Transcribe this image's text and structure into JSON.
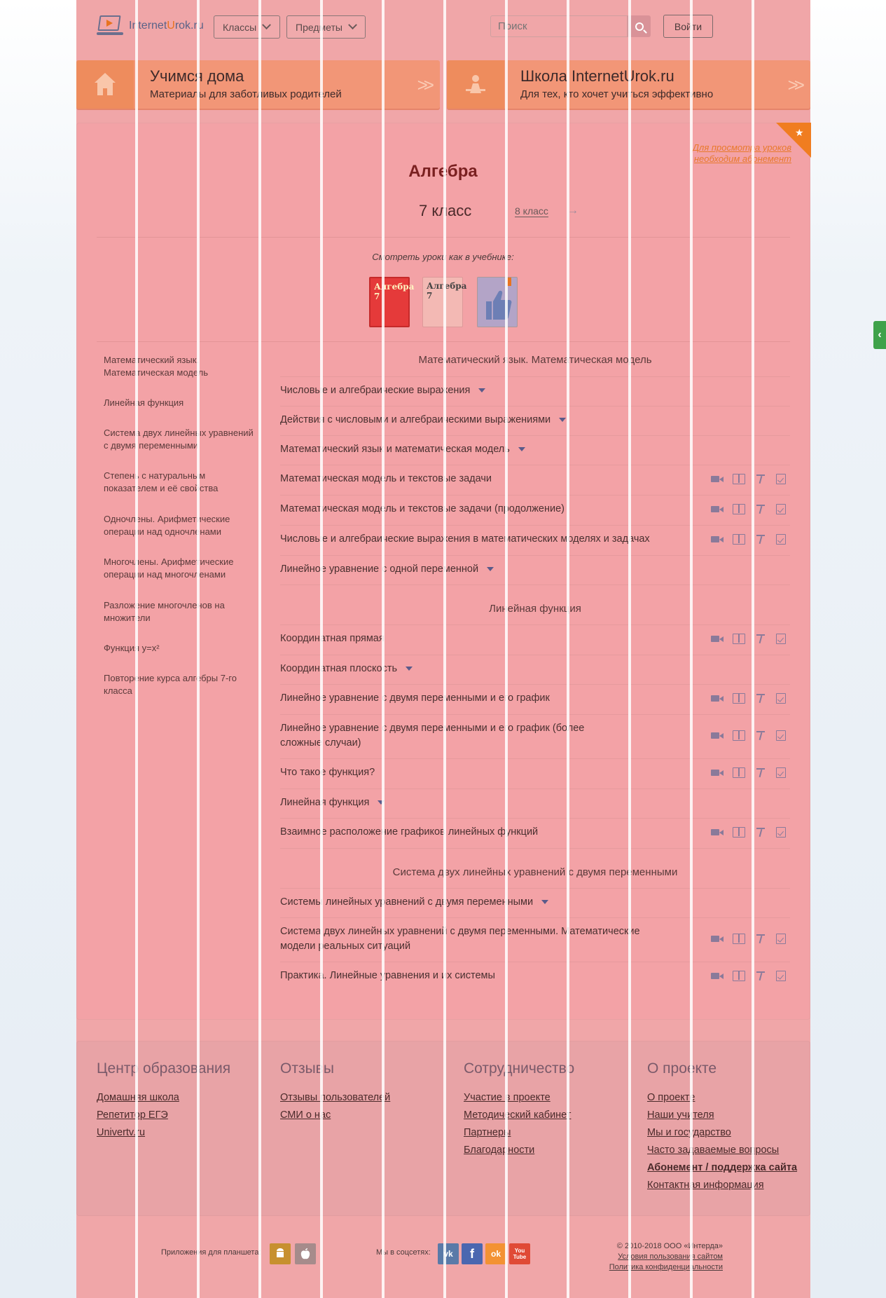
{
  "header": {
    "logo": "InternetUrok.ru",
    "logo_parts": [
      "Internet",
      "U",
      "rok.ru"
    ],
    "classes_label": "Классы",
    "subjects_label": "Предметы",
    "search_placeholder": "Поиск",
    "login_label": "Войти"
  },
  "banners": [
    {
      "title": "Учимся дома",
      "subtitle": "Материалы для заботливых родителей"
    },
    {
      "title": "Школа InternetUrok.ru",
      "subtitle": "Для тех, кто хочет учиться эффективно"
    }
  ],
  "main": {
    "subscription_note": "Для просмотра уроков необходим абонемент",
    "title": "Алгебра",
    "current_grade": "7 класс",
    "next_grade": "8 класс",
    "books_label": "Смотреть уроки как в учебнике:",
    "books": [
      "Алгебра 7",
      "Алгебра 7"
    ]
  },
  "sidebar": {
    "items": [
      "Математический язык. Математическая модель",
      "Линейная функция",
      "Система двух линейных уравнений с двумя переменными",
      "Степень с натуральным показателем и её свойства",
      "Одночлены. Арифметические операции над одночленами",
      "Многочлены. Арифметические операции над многочленами",
      "Разложение многочленов на множители",
      "Функция y=x²",
      "Повторение курса алгебры 7-го класса"
    ]
  },
  "sections": [
    {
      "title": "Математический язык. Математическая модель",
      "lessons": [
        {
          "label": "Числовые и алгебраические выражения",
          "expandable": true
        },
        {
          "label": "Действия с числовыми и алгебраическими выражениями",
          "expandable": true
        },
        {
          "label": "Математический язык и математическая модель",
          "expandable": true
        },
        {
          "label": "Математическая модель и текстовые задачи",
          "expandable": false
        },
        {
          "label": "Математическая модель и текстовые задачи (продолжение)",
          "expandable": false
        },
        {
          "label": "Числовые и алгебраические выражения в математических моделях и задачах",
          "expandable": false
        },
        {
          "label": "Линейное уравнение с одной переменной",
          "expandable": true
        }
      ]
    },
    {
      "title": "Линейная функция",
      "lessons": [
        {
          "label": "Координатная прямая",
          "expandable": false
        },
        {
          "label": "Координатная плоскость",
          "expandable": true
        },
        {
          "label": "Линейное уравнение с двумя переменными и его график",
          "expandable": false
        },
        {
          "label": "Линейное уравнение с двумя переменными и его график (более сложные случаи)",
          "expandable": false
        },
        {
          "label": "Что такое функция?",
          "expandable": false
        },
        {
          "label": "Линейная функция",
          "expandable": true
        },
        {
          "label": "Взаимное расположение графиков линейных функций",
          "expandable": false
        }
      ]
    },
    {
      "title": "Система двух линейных уравнений с двумя переменными",
      "lessons": [
        {
          "label": "Системы линейных уравнений с двумя переменными",
          "expandable": true
        },
        {
          "label": "Система двух линейных уравнений с двумя переменными. Математические модели реальных ситуаций",
          "expandable": false
        },
        {
          "label": "Практика. Линейные уравнения и их системы",
          "expandable": false
        }
      ]
    }
  ],
  "footer": {
    "columns": [
      {
        "title": "Центр образования",
        "links": [
          "Домашняя школа",
          "Репетитор ЕГЭ",
          "Univertv.ru"
        ]
      },
      {
        "title": "Отзывы",
        "links": [
          "Отзывы пользователей",
          "СМИ о нас"
        ]
      },
      {
        "title": "Сотрудничество",
        "links": [
          "Участие в проекте",
          "Методический кабинет",
          "Партнеры",
          "Благодарности"
        ]
      },
      {
        "title": "О проекте",
        "links": [
          "О проекте",
          "Наши учителя",
          "Мы и государство",
          "Часто задаваемые вопросы",
          "Абонемент / поддержка сайта",
          "Контактная информация"
        ]
      }
    ],
    "apps_label": "Приложения для планшета:",
    "social_label": "Мы в соцсетях:",
    "social_icons": [
      {
        "name": "vk-icon",
        "glyph": "vk",
        "color": "#5a7aa8"
      },
      {
        "name": "facebook-icon",
        "glyph": "f",
        "color": "#4a67b0"
      },
      {
        "name": "odnoklassniki-icon",
        "glyph": "ok",
        "color": "#f39233"
      },
      {
        "name": "youtube-icon",
        "glyph": "You Tube",
        "color": "#e04a36"
      }
    ],
    "copyright": "© 2010-2018 ООО «Интерда»",
    "terms": "Условия пользования сайтом",
    "privacy": "Политика конфиденциальности"
  },
  "colors": {
    "accent": "#e8731f",
    "overlay": "#f0a6a8",
    "title": "#7a2020"
  }
}
